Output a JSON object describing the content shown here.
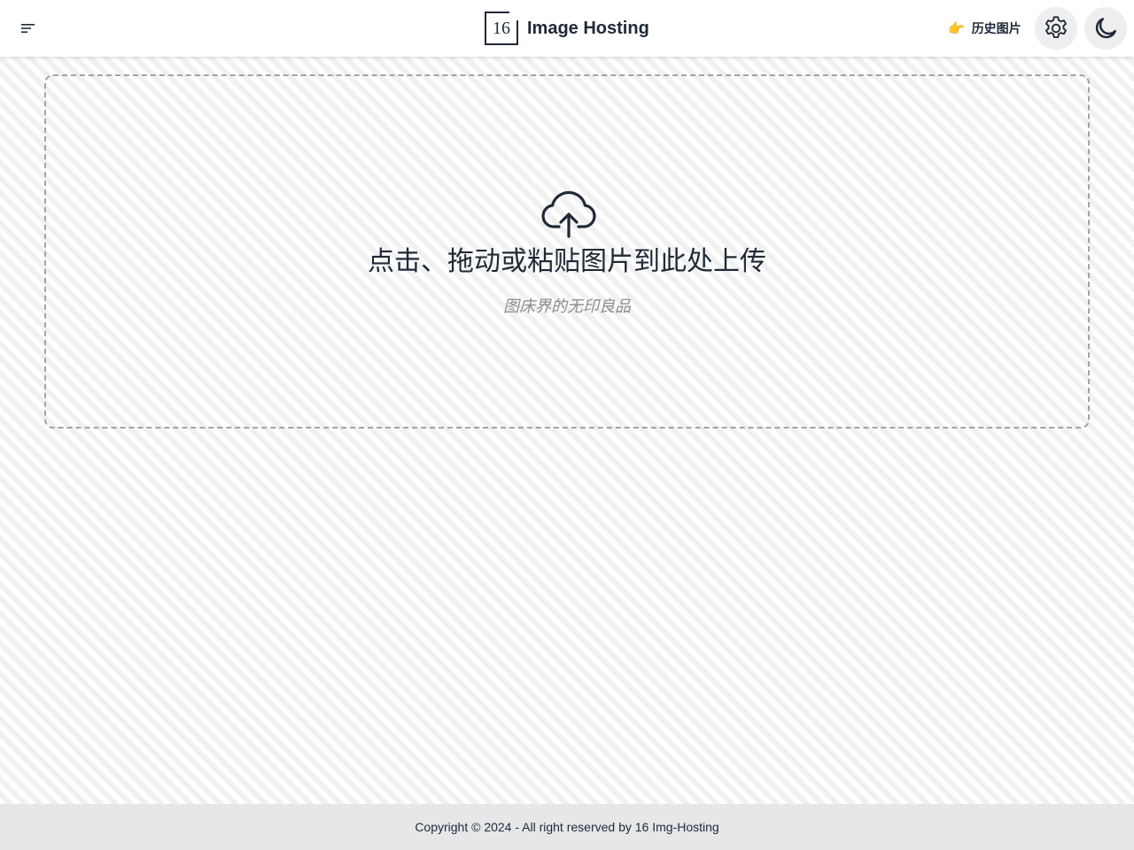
{
  "header": {
    "menu_icon": "menu-icon",
    "logo_text": "16",
    "brand_name": "Image Hosting",
    "history": {
      "icon": "pointing-hand-icon",
      "icon_glyph": "👉",
      "label": "历史图片"
    },
    "settings_icon": "gear-icon",
    "theme_icon": "moon-icon"
  },
  "upload": {
    "icon": "cloud-upload-icon",
    "title": "点击、拖动或粘贴图片到此处上传",
    "subtitle": "图床界的无印良品"
  },
  "footer": {
    "copyright": "Copyright © 2024 - All right reserved by 16 Img-Hosting"
  },
  "colors": {
    "text": "#1f2937",
    "header_bg": "#ffffff",
    "footer_bg": "#e5e7e8",
    "button_bg": "#eeeeee",
    "dashed_border": "#a3a3a3",
    "subtitle": "#8b8b8b"
  }
}
